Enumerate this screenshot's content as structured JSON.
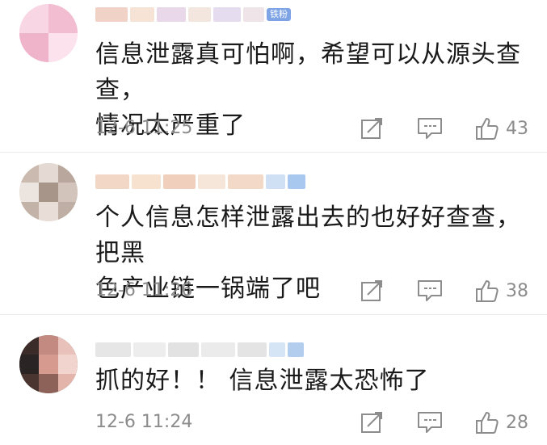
{
  "comments": [
    {
      "badge": "铁粉",
      "text_line1": "信息泄露真可怕啊，希望可以从源头查查，",
      "text_line2": "情况太严重了",
      "timestamp": "12-6 11:25",
      "likes": "43",
      "avatar_palette": [
        "#f7c6d8",
        "#f2b3cc",
        "#fbe0ea",
        "#f5d0df"
      ]
    },
    {
      "badge": "",
      "text_line1": "个人信息怎样泄露出去的也好好查查，把黑",
      "text_line2": "色产业链一锅端了吧",
      "timestamp": "12-6 11:26",
      "likes": "38",
      "avatar_palette": [
        "#c9b8ad",
        "#e7dcd6",
        "#a8958a",
        "#d8cbc4"
      ]
    },
    {
      "badge": "",
      "text_line1": "抓的好！！ 信息泄露太恐怖了",
      "text_line2": "",
      "timestamp": "12-6 11:24",
      "likes": "28",
      "avatar_palette": [
        "#5a3a33",
        "#e8b9b1",
        "#2b2424",
        "#d79a8f"
      ]
    }
  ],
  "icons": {
    "share": "share-icon",
    "comment": "comment-icon",
    "like": "thumbs-up-icon"
  },
  "colors": {
    "text": "#1a1a1a",
    "meta": "#8c8c8c",
    "badge": "#7fa4e6"
  }
}
